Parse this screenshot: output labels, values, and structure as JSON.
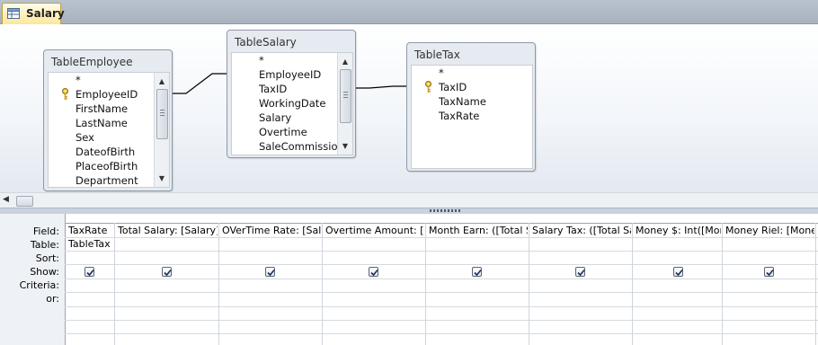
{
  "tab": {
    "label": "Salary",
    "icon": "query-icon"
  },
  "tables": [
    {
      "title": "TableEmployee",
      "fields": [
        "*",
        "EmployeeID",
        "FirstName",
        "LastName",
        "Sex",
        "DateofBirth",
        "PlaceofBirth",
        "Department"
      ],
      "primary_key": "EmployeeID"
    },
    {
      "title": "TableSalary",
      "fields": [
        "*",
        "EmployeeID",
        "TaxID",
        "WorkingDate",
        "Salary",
        "Overtime",
        "SaleCommission"
      ]
    },
    {
      "title": "TableTax",
      "fields": [
        "*",
        "TaxID",
        "TaxName",
        "TaxRate"
      ],
      "primary_key": "TaxID"
    }
  ],
  "grid": {
    "row_labels": [
      "Field:",
      "Table:",
      "Sort:",
      "Show:",
      "Criteria:",
      "or:"
    ],
    "columns": [
      {
        "field": "TaxRate",
        "table": "TableTax",
        "show": true
      },
      {
        "field": "Total Salary: [Salary]*([",
        "table": "",
        "show": true
      },
      {
        "field": "OVerTime Rate: [Salar",
        "table": "",
        "show": true
      },
      {
        "field": "Overtime Amount: [Ov",
        "table": "",
        "show": true
      },
      {
        "field": "Month Earn: ([Total Sa",
        "table": "",
        "show": true
      },
      {
        "field": "Salary Tax: ([Total Sala",
        "table": "",
        "show": true
      },
      {
        "field": "Money $: Int([Mon",
        "table": "",
        "show": true
      },
      {
        "field": "Money Riel: [Mone",
        "table": "",
        "show": true
      }
    ]
  },
  "colors": {
    "tab_active": "#fbe79b",
    "grid_header": "#eef1f5",
    "join_line": "#000000"
  }
}
